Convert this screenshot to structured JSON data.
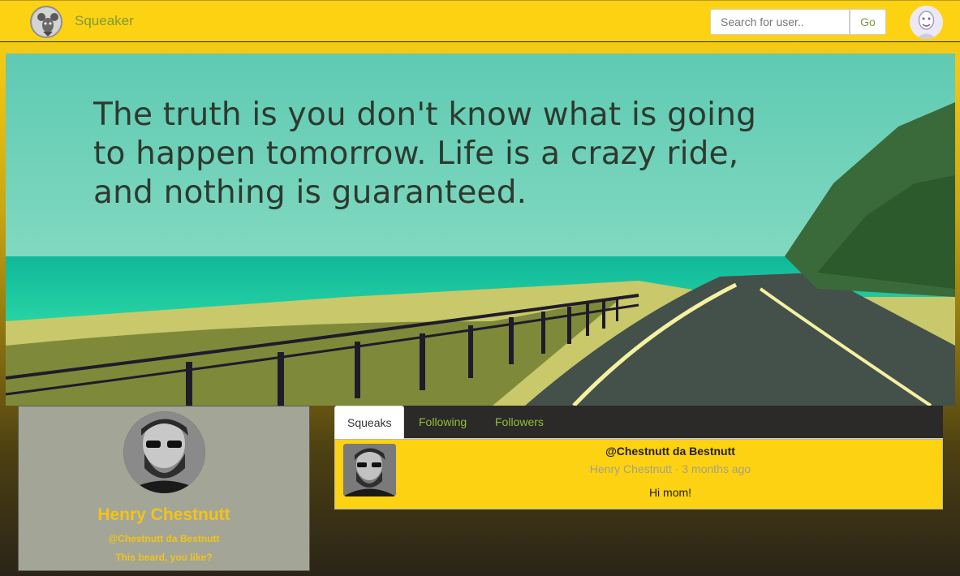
{
  "navbar": {
    "brand_name": "Squeaker",
    "brand_icon": "rat-logo-icon",
    "search": {
      "placeholder": "Search for user..",
      "value": ""
    },
    "go_label": "Go",
    "user_avatar_icon": "user-avatar-icon"
  },
  "cover": {
    "quote": "The truth is you don't know what is going\nto happen tomorrow.  Life is a crazy ride,\nand nothing is guaranteed."
  },
  "profile": {
    "name": "Henry Chestnutt",
    "handle": "@Chestnutt da Bestnutt",
    "bio": "This beard, you like?"
  },
  "tabs": [
    {
      "label": "Squeaks",
      "active": true
    },
    {
      "label": "Following",
      "active": false
    },
    {
      "label": "Followers",
      "active": false
    }
  ],
  "squeaks": [
    {
      "handle": "@Chestnutt da Bestnutt",
      "meta": "Henry Chestnutt · 3 months ago",
      "body": "Hi mom!"
    }
  ],
  "colors": {
    "navbar": "#fdd212",
    "accent_green": "#7d9a3a",
    "profile_name": "#f4c318",
    "tab_bar": "#2b2a28"
  }
}
